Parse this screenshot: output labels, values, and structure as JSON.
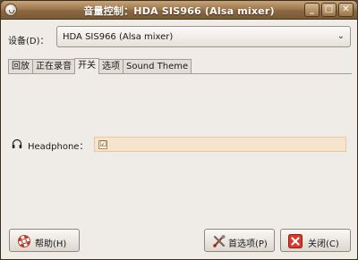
{
  "window": {
    "title": "音量控制：HDA SIS966 (Alsa mixer)",
    "buttons": {
      "minimize": "_",
      "maximize": "□",
      "close": "✕"
    }
  },
  "device": {
    "label": "设备(D)：",
    "selected": "HDA SIS966 (Alsa mixer)"
  },
  "tabs": [
    {
      "label": "回放"
    },
    {
      "label": "正在录音"
    },
    {
      "label": "开关"
    },
    {
      "label": "选项"
    },
    {
      "label": "Sound Theme"
    }
  ],
  "active_tab": "开关",
  "switches": [
    {
      "label": "Headphone：",
      "checked": true,
      "check_glyph": "☑"
    }
  ],
  "buttons": {
    "help": "帮助(H)",
    "preferences": "首选项(P)",
    "close": "关闭(C)"
  },
  "icons": {
    "window_menu": "ubuntu-audio-icon",
    "headphone": "headphone-icon",
    "help": "help-lifebuoy-icon",
    "preferences": "preferences-tools-icon",
    "close": "close-red-icon"
  }
}
